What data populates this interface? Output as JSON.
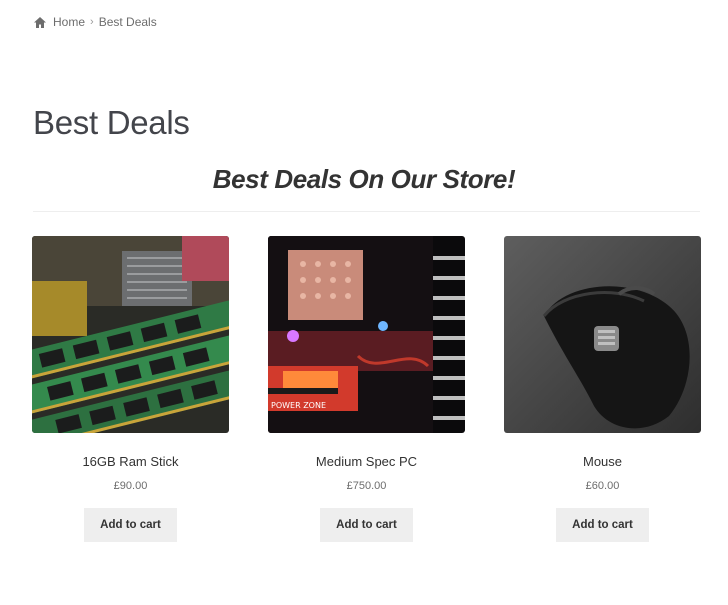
{
  "breadcrumb": {
    "icon": "home-icon",
    "home_label": "Home",
    "separator_icon": "chevron-right-icon",
    "current_label": "Best Deals"
  },
  "page": {
    "title": "Best Deals",
    "section_heading": "Best Deals On Our Store!"
  },
  "products": [
    {
      "name": "16GB Ram Stick",
      "price": "£90.00",
      "button_label": "Add to cart"
    },
    {
      "name": "Medium Spec PC",
      "price": "£750.00",
      "button_label": "Add to cart"
    },
    {
      "name": "Mouse",
      "price": "£60.00",
      "button_label": "Add to cart"
    }
  ],
  "colors": {
    "text": "#43454b",
    "muted": "#6d6d6d",
    "button_bg": "#eeeeee"
  }
}
